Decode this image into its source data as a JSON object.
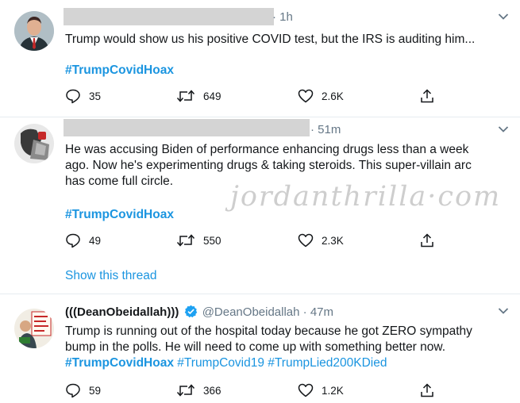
{
  "tweets": [
    {
      "time": "1h",
      "text": "Trump would show us his positive COVID test, but the IRS is auditing him...",
      "hashtag": "#TrumpCovidHoax",
      "replies": "35",
      "retweets": "649",
      "likes": "2.6K"
    },
    {
      "time": "51m",
      "text_lines": [
        "He was accusing Biden of performance enhancing drugs less than a week",
        "ago. Now he's experimenting drugs & taking steroids. This super-villain arc",
        "has come full circle."
      ],
      "hashtag": "#TrumpCovidHoax",
      "replies": "49",
      "retweets": "550",
      "likes": "2.3K",
      "show_thread": "Show this thread"
    },
    {
      "name": "(((DeanObeidallah)))",
      "handle": "@DeanObeidallah",
      "time": "47m",
      "text_lines": [
        "Trump is running out of the hospital today because he got ZERO sympathy",
        "bump in the polls.  He will need to come up with something better now."
      ],
      "hashtags": [
        "#TrumpCovidHoax",
        "#TrumpCovid19",
        "#TrumpLied200KDied"
      ],
      "replies": "59",
      "retweets": "366",
      "likes": "1.2K"
    }
  ],
  "watermark": "jordanthrilla·com",
  "colors": {
    "link": "#1b95e0",
    "muted": "#657786",
    "separator": "#e6ecf0"
  }
}
